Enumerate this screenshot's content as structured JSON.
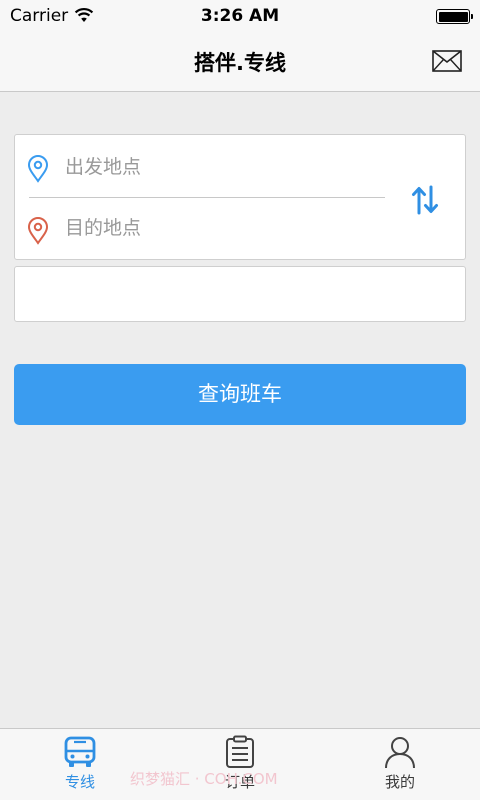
{
  "status_bar": {
    "carrier": "Carrier",
    "time": "3:26 AM"
  },
  "nav": {
    "title": "搭伴.专线"
  },
  "form": {
    "origin_placeholder": "出发地点",
    "destination_placeholder": "目的地点",
    "date_value": "",
    "search_label": "查询班车"
  },
  "tabs": [
    {
      "label": "专线",
      "icon": "bus-icon",
      "active": true
    },
    {
      "label": "订单",
      "icon": "clipboard-icon",
      "active": false
    },
    {
      "label": "我的",
      "icon": "user-icon",
      "active": false
    }
  ],
  "watermark": "织梦猫汇 · COH.COM",
  "colors": {
    "accent": "#3a9cf0",
    "origin_pin": "#3a9cf0",
    "destination_pin": "#d9624a",
    "tab_active": "#2f8fe3",
    "background": "#ededed"
  }
}
